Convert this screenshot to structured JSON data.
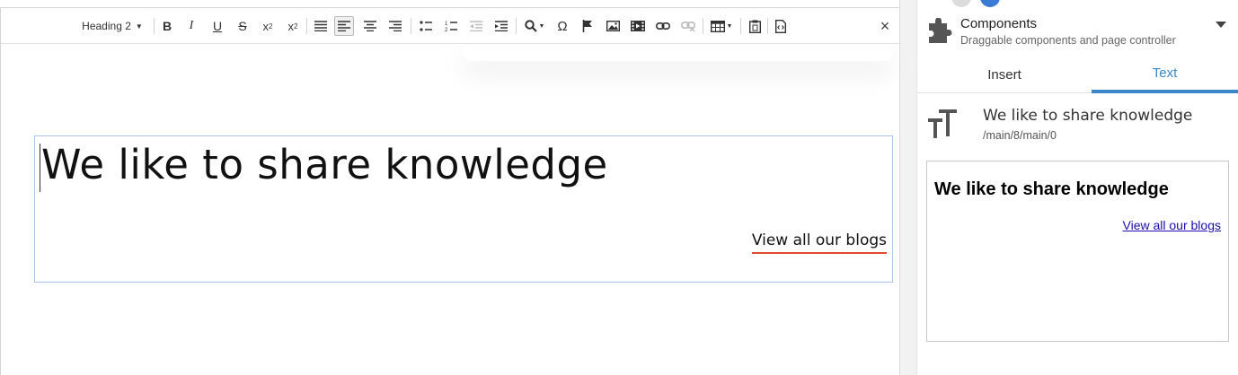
{
  "toolbar": {
    "format_select": "Heading 2",
    "buttons": [
      "bold",
      "italic",
      "underline",
      "strikethrough",
      "superscript",
      "subscript",
      "justify",
      "align-left",
      "align-center",
      "align-right",
      "bulleted-list",
      "numbered-list",
      "outdent",
      "indent",
      "find",
      "special-char",
      "anchor",
      "image",
      "media",
      "link",
      "unlink",
      "table",
      "paste",
      "source"
    ],
    "active": "align-left",
    "close_glyph": "×"
  },
  "editor": {
    "heading": "We like to share knowledge",
    "link": "View all our blogs"
  },
  "panel": {
    "title": "Components",
    "subtitle": "Draggable components and page controller",
    "tabs": [
      {
        "label": "Insert",
        "active": false
      },
      {
        "label": "Text",
        "active": true
      }
    ],
    "selected": {
      "title": "We like to share knowledge",
      "path": "/main/8/main/0"
    },
    "preview": {
      "heading": "We like to share knowledge",
      "link": "View all our blogs"
    }
  },
  "colors": {
    "accent": "#3a86c8",
    "link_underline": "#e04a2e",
    "selection_border": "#a8c6e4"
  }
}
